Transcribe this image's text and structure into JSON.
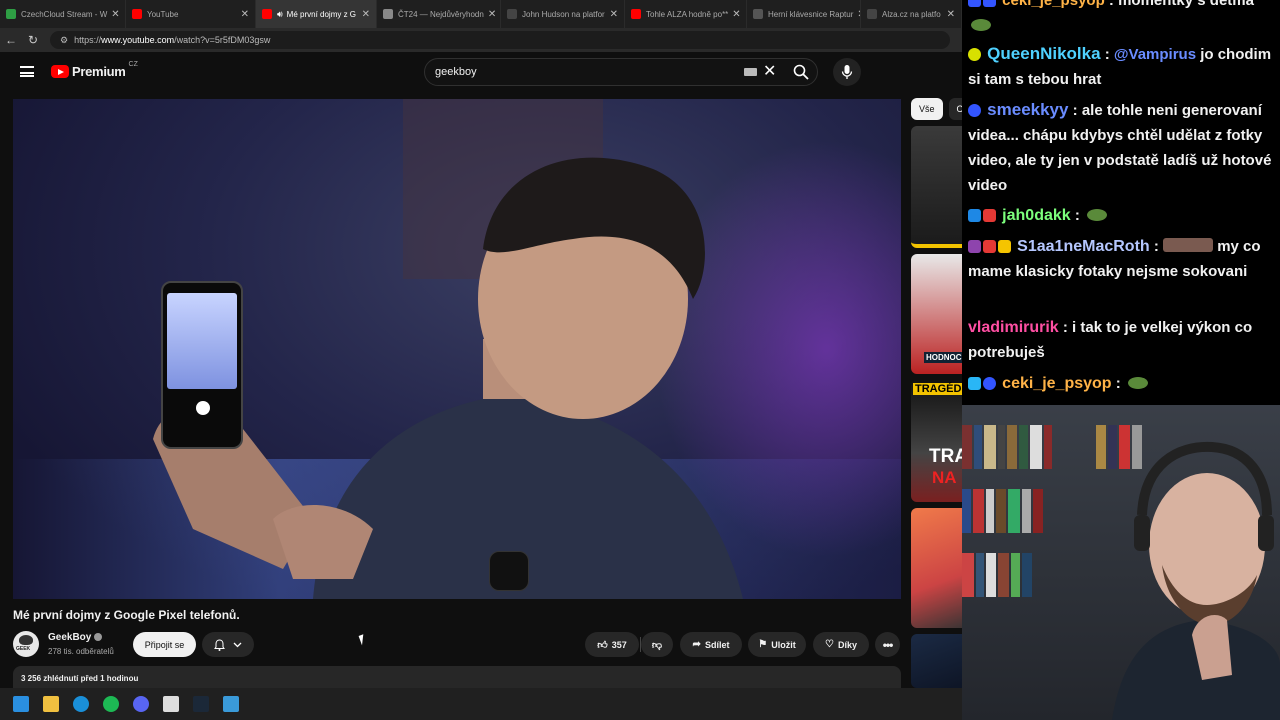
{
  "browser": {
    "tabs": [
      {
        "title": "CzechCloud Stream - W",
        "active": false,
        "icon_color": "#2e9e44"
      },
      {
        "title": "YouTube",
        "active": false,
        "icon_color": "#ff0000"
      },
      {
        "title": "Mé první dojmy z G",
        "active": true,
        "icon_color": "#ff0000"
      },
      {
        "title": "ČT24 — Nejdůvěryhodn",
        "active": false,
        "icon_color": "#888888"
      },
      {
        "title": "John Hudson na platfor",
        "active": false,
        "icon_color": "#444444"
      },
      {
        "title": "Tohle ALZA hodně po**",
        "active": false,
        "icon_color": "#ff0000"
      },
      {
        "title": "Herní klávesnice Raptur",
        "active": false,
        "icon_color": "#555555"
      },
      {
        "title": "Alza.cz na platfo",
        "active": false,
        "icon_color": "#444444"
      }
    ],
    "url_prefix": "https://",
    "url_host": "www.youtube.com",
    "url_path": "/watch?v=5r5fDM03gsw"
  },
  "youtube": {
    "logo_text": "Premium",
    "logo_country": "CZ",
    "search_value": "geekboy",
    "video": {
      "title": "Mé první dojmy z Google Pixel telefonů.",
      "channel": "GeekBoy",
      "subscribers": "278 tis. odběratelů",
      "join_label": "Připojit se",
      "likes": "357",
      "share_label": "Sdílet",
      "save_label": "Uložit",
      "thanks_label": "Díky",
      "views_date": "3 256 zhlédnutí  před 1 hodinou"
    },
    "chips": [
      "Vše",
      "O"
    ],
    "sidebar_labels": [
      "HODNOC",
      "TRAGÉDI",
      "TRA",
      "NA"
    ]
  },
  "chat": {
    "messages": [
      {
        "user": "ceki_je_psyop",
        "text": "momentky s detma",
        "color": "#ffb347"
      },
      {
        "user": "QueenNikolka",
        "mention": "@Vampirus",
        "text": "jo chodim si tam s tebou hrat",
        "color": "#4fd1ff"
      },
      {
        "user": "smeekkyy",
        "text": "ale tohle neni generovaní videa... chápu kdybys chtěl udělat z fotky video, ale ty jen v podstatě ladíš už hotové video",
        "color": "#6a8cff"
      },
      {
        "user": "jah0dakk",
        "text": "",
        "color": "#7cff7c"
      },
      {
        "user": "S1aa1neMacRoth",
        "text": "my co mame klasicky fotaky nejsme sokovani",
        "color": "#b5c7ff"
      },
      {
        "user": "vladimirurik",
        "text": "i tak to je velkej výkon co potrebuješ",
        "color": "#ff4fa3"
      },
      {
        "user": "ceki_je_psyop",
        "text": "",
        "color": "#ffb347"
      }
    ]
  },
  "taskbar": {
    "icons": [
      "windows-start-icon",
      "file-explorer-icon",
      "edge-browser-icon",
      "spotify-icon",
      "discord-icon",
      "obs-icon",
      "steam-icon",
      "app-icon"
    ]
  }
}
